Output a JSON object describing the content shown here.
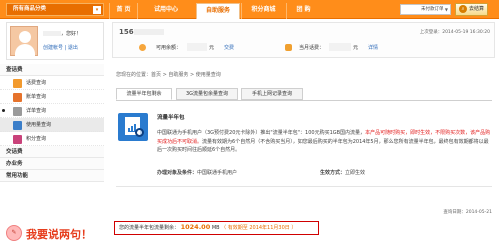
{
  "nav": {
    "all_categories": "所有商品分类",
    "tabs": [
      "首 页",
      "试用中心",
      "自助服务",
      "积分商城",
      "团 购"
    ],
    "active_tab": "自助服务",
    "order_select": "未付款订单",
    "go_button": "去结算"
  },
  "user": {
    "greeting": "，您好！",
    "links": "创建帐号 | 退出"
  },
  "sidebar": {
    "sections": [
      {
        "title": "查话费",
        "items": [
          "话费查询",
          "账单查询",
          "详单查询",
          "使用量查询",
          "积分查询"
        ]
      },
      {
        "title": "交话费",
        "items": []
      },
      {
        "title": "办业务",
        "items": []
      },
      {
        "title": "常用功能",
        "items": []
      }
    ],
    "active_item": "使用量查询",
    "ad_text": "我要说两句！"
  },
  "balance": {
    "phone_prefix": "156",
    "last_login": "上次登录：2014-05-19 16:30:20",
    "available_label": "可用余额：",
    "available_unit": "元",
    "recharge_link": "交费",
    "month_label": "当月话费：",
    "month_unit": "元",
    "detail_link": "详情"
  },
  "breadcrumb": "您现在的位置：首页 > 自助服务 > 使用量查询",
  "tabs": [
    "流量半年包剩余",
    "3G流量包余量查询",
    "手机上网记录查询"
  ],
  "package": {
    "title": "流量半年包",
    "desc_1": "中国联通为手机用户（3G预付费20元卡除外）推出\"流量半年包\"：100元购买1GB国内流量，",
    "desc_red": "本产品可随时购买，即时生效，不限购买次数，该产品购买成功后不可取消。",
    "desc_2": "流量有效期为6个自然月（不含购买当月），如您最后购买的半年包为2014年5月，那么您所有流量半年包，最终包有效期都将以最后一次购买时间往后顺延6个自然月。",
    "target_label": "办理对象及条件：",
    "target_value": "中国联通手机用户",
    "method_label": "生效方式：",
    "method_value": "立即生效"
  },
  "query_time": "查询日期：2014-05-21",
  "result": {
    "label": "您的流量半年包流量剩余：",
    "value": "1024.00",
    "unit": "MB",
    "expire": "（ 有效期至 2014年11月30日 ）"
  }
}
